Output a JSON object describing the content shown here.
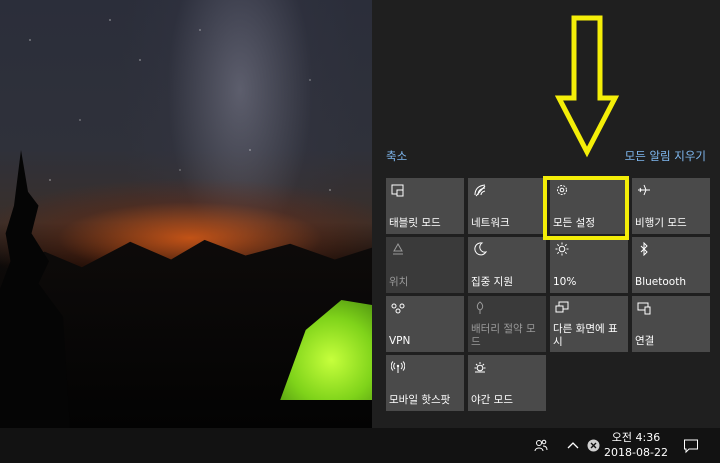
{
  "action_center": {
    "collapse_link": "축소",
    "clear_all_link": "모든 알림 지우기",
    "tiles": [
      {
        "label": "태블릿 모드",
        "icon": "tablet-mode-icon"
      },
      {
        "label": "네트워크",
        "icon": "network-icon"
      },
      {
        "label": "모든 설정",
        "icon": "gear-icon"
      },
      {
        "label": "비행기 모드",
        "icon": "airplane-icon"
      },
      {
        "label": "위치",
        "icon": "location-icon"
      },
      {
        "label": "집중 지원",
        "icon": "moon-icon"
      },
      {
        "label": "10%",
        "icon": "brightness-icon"
      },
      {
        "label": "Bluetooth",
        "icon": "bluetooth-icon"
      },
      {
        "label": "VPN",
        "icon": "vpn-icon"
      },
      {
        "label": "배터리 절약 모드",
        "icon": "battery-saver-icon"
      },
      {
        "label": "다른 화면에 표시",
        "icon": "project-icon"
      },
      {
        "label": "연결",
        "icon": "connect-icon"
      },
      {
        "label": "모바일 핫스팟",
        "icon": "hotspot-icon"
      },
      {
        "label": "야간 모드",
        "icon": "night-light-icon"
      }
    ]
  },
  "annotation": {
    "color": "#f4ee08"
  },
  "taskbar": {
    "time": "오전 4:36",
    "date": "2018-08-22"
  }
}
